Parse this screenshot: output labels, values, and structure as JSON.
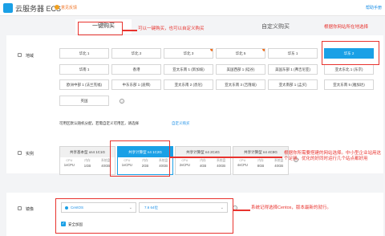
{
  "header": {
    "title": "云服务器 ECS",
    "feedback": "意见反馈",
    "help": "帮助手册"
  },
  "tabs": {
    "quick": "一键购买",
    "custom": "自定义购买"
  },
  "region": {
    "label": "地域",
    "row1": [
      "华北 1",
      "华北 2",
      "华北 3",
      "华北 5",
      "华东 1",
      "华东 2"
    ],
    "row2": [
      "华南 1",
      "香港",
      "亚太东南 1 (新加坡)",
      "美国西部 1 (硅谷)",
      "美国东部 1 (弗吉尼亚)",
      "亚太东北 1 (东京)"
    ],
    "row3": [
      "欧洲中部 1 (法兰克福)",
      "中东东部 1 (迪拜)",
      "亚太东南 2 (悉尼)",
      "亚太东南 3 (吉隆坡)",
      "亚太南部 1 (孟买)",
      "亚太东南 5 (雅加达)"
    ],
    "row4": [
      "英国"
    ],
    "note": "可用区默认随机分配，若需自定义可用区，请选择",
    "note_link": "自定义购买"
  },
  "instance": {
    "label": "实例",
    "cards": [
      {
        "name": "共享基本型 xn4 1C1G",
        "cpu": "1vCPU",
        "mem": "1GB",
        "disk": "40GB"
      },
      {
        "name": "共享计算型 n4 1C2G",
        "cpu": "1vCPU",
        "mem": "2GB",
        "disk": "40GB"
      },
      {
        "name": "共享计算型 n4 2C4G",
        "cpu": "2vCPU",
        "mem": "4GB",
        "disk": "40GB"
      },
      {
        "name": "共享计算型 n4 4C8G",
        "cpu": "4vCPU",
        "mem": "8GB",
        "disk": "40GB"
      }
    ],
    "col_labels": {
      "cpu": "CPU",
      "mem": "内存",
      "disk": "系统盘"
    }
  },
  "image": {
    "label": "镜像",
    "os": "CentOS",
    "version": "7.6 64位",
    "security": "安全加固"
  },
  "annotations": {
    "a1": "可以一键购买，也可以自定义购买",
    "a2": "根据你网站所在地选择",
    "a3": "根据你所需要搭建的网站选择。中小型企业站用这个足够，优化的好同时运行几个站点都好用",
    "a4": "系统记得选择Centos，版本最新的就行。"
  },
  "colors": {
    "accent": "#1aa0e6",
    "annotation": "#e8332e"
  }
}
